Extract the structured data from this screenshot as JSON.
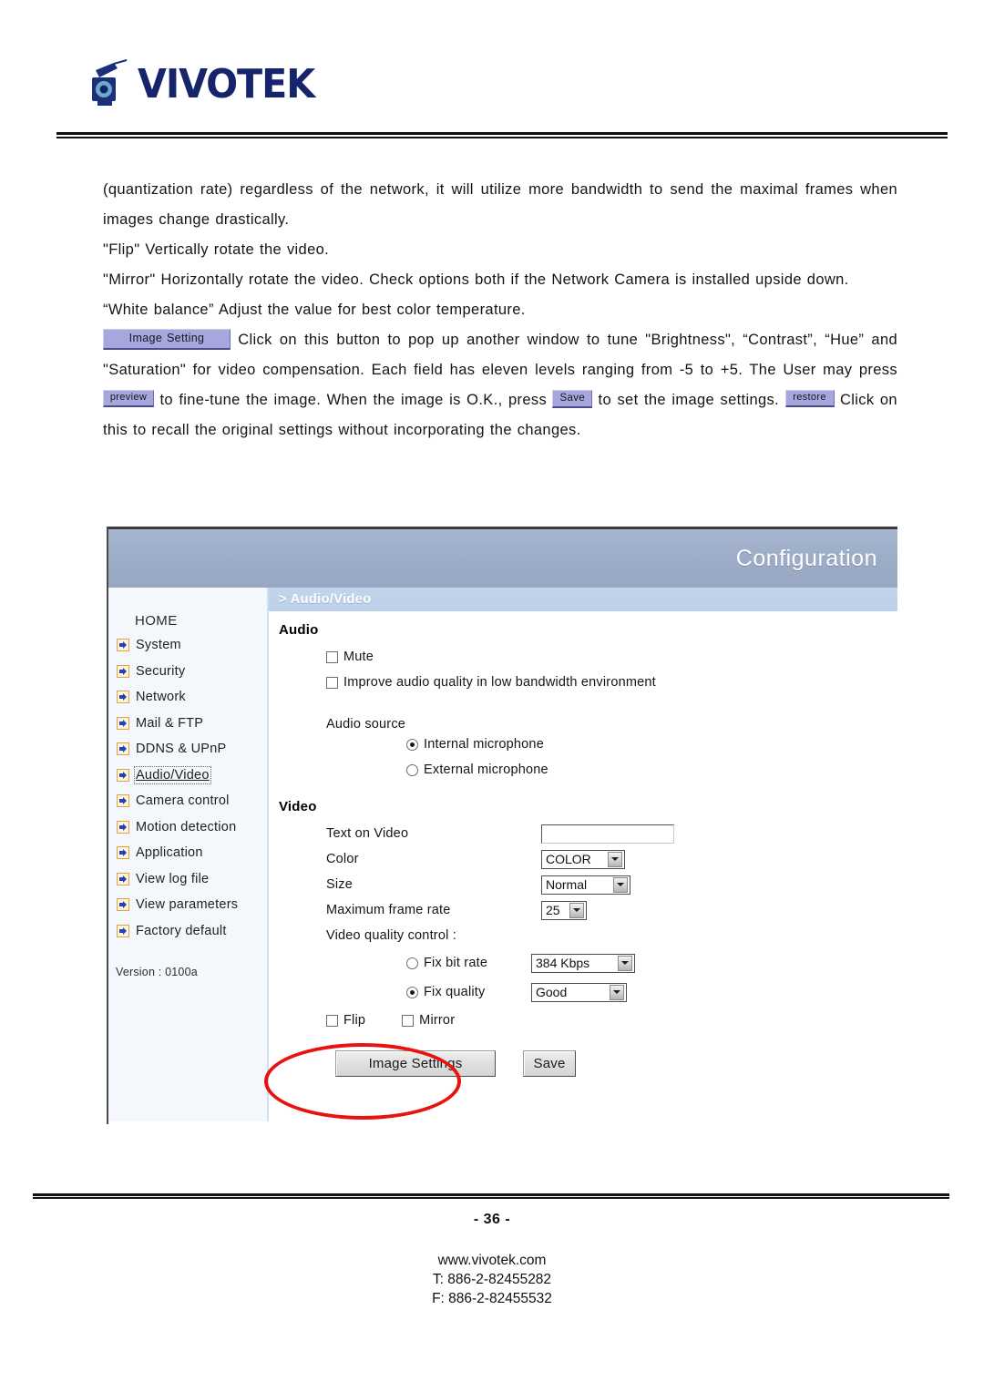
{
  "brand": {
    "logo_text": "VIVOTEK",
    "logo_icon": "camera-icon"
  },
  "body": {
    "paragraph_1": "(quantization rate) regardless of the network, it will utilize more bandwidth to send the maximal frames when images change drastically.",
    "paragraph_2": "\"Flip\" Vertically rotate the video.",
    "paragraph_3": "\"Mirror\" Horizontally rotate the video. Check options both if the Network Camera is installed upside down.",
    "paragraph_4": "“White balance” Adjust the value for best color temperature.",
    "paragraph_5_a": "Click on this button to pop up another window to tune \"Brightness\", “Contrast”, “Hue” and \"Saturation\" for video compensation. Each field has eleven levels ranging from -5 to +5. The User may press",
    "paragraph_5_b": "to fine-tune the image. When the image is O.K., press",
    "paragraph_5_c": "to set the image settings.",
    "paragraph_5_d": "Click on this to recall the original settings without incorporating the changes.",
    "inline_buttons": {
      "image_setting": "Image Setting",
      "preview": "preview",
      "save": "Save",
      "restore": "restore"
    }
  },
  "screenshot": {
    "title": "Configuration",
    "breadcrumb": "> Audio/Video",
    "sidebar": {
      "home": "HOME",
      "items": [
        {
          "label": "System",
          "icon": "arrow-right-icon",
          "selected": false
        },
        {
          "label": "Security",
          "icon": "arrow-right-icon",
          "selected": false
        },
        {
          "label": "Network",
          "icon": "arrow-right-icon",
          "selected": false
        },
        {
          "label": "Mail & FTP",
          "icon": "arrow-right-icon",
          "selected": false
        },
        {
          "label": "DDNS & UPnP",
          "icon": "arrow-right-icon",
          "selected": false
        },
        {
          "label": "Audio/Video",
          "icon": "arrow-right-icon",
          "selected": true
        },
        {
          "label": "Camera control",
          "icon": "arrow-right-icon",
          "selected": false
        },
        {
          "label": "Motion detection",
          "icon": "arrow-right-icon",
          "selected": false
        },
        {
          "label": "Application",
          "icon": "arrow-right-icon",
          "selected": false
        },
        {
          "label": "View log file",
          "icon": "arrow-right-icon",
          "selected": false
        },
        {
          "label": "View parameters",
          "icon": "arrow-right-icon",
          "selected": false
        },
        {
          "label": "Factory default",
          "icon": "arrow-right-icon",
          "selected": false
        }
      ],
      "version": "Version : 0100a"
    },
    "audio": {
      "section_title": "Audio",
      "mute_label": "Mute",
      "mute_checked": false,
      "improve_label": "Improve audio quality in low bandwidth environment",
      "improve_checked": false,
      "source_label": "Audio source",
      "source_options": [
        {
          "label": "Internal microphone",
          "selected": true
        },
        {
          "label": "External microphone",
          "selected": false
        }
      ]
    },
    "video": {
      "section_title": "Video",
      "text_on_video_label": "Text on Video",
      "text_on_video_value": "",
      "color_label": "Color",
      "color_value": "COLOR",
      "size_label": "Size",
      "size_value": "Normal",
      "frame_rate_label": "Maximum frame rate",
      "frame_rate_value": "25",
      "quality_control_label": "Video quality control :",
      "fix_bit_rate_label": "Fix bit rate",
      "fix_bit_rate_selected": false,
      "fix_bit_rate_value": "384 Kbps",
      "fix_quality_label": "Fix quality",
      "fix_quality_selected": true,
      "fix_quality_value": "Good",
      "flip_label": "Flip",
      "flip_checked": false,
      "mirror_label": "Mirror",
      "mirror_checked": false
    },
    "buttons": {
      "image_settings": "Image Settings",
      "save": "Save"
    },
    "annotation": {
      "type": "red-ellipse-highlight",
      "color": "#E8130F",
      "targets": "image-settings-button"
    }
  },
  "footer": {
    "page_number": "- 36 -",
    "website": "www.vivotek.com",
    "tel": "T: 886-2-82455282",
    "fax": "F: 886-2-82455532"
  },
  "colors": {
    "title_bar": "#9CABC6",
    "breadcrumb_bar": "#BDD0E9",
    "sidebar_bg": "#F4F8FC",
    "inline_button": "#A7A7DE",
    "logo_navy": "#16256B",
    "annotation_red": "#E8130F",
    "icon_orange": "#E2A23A"
  }
}
